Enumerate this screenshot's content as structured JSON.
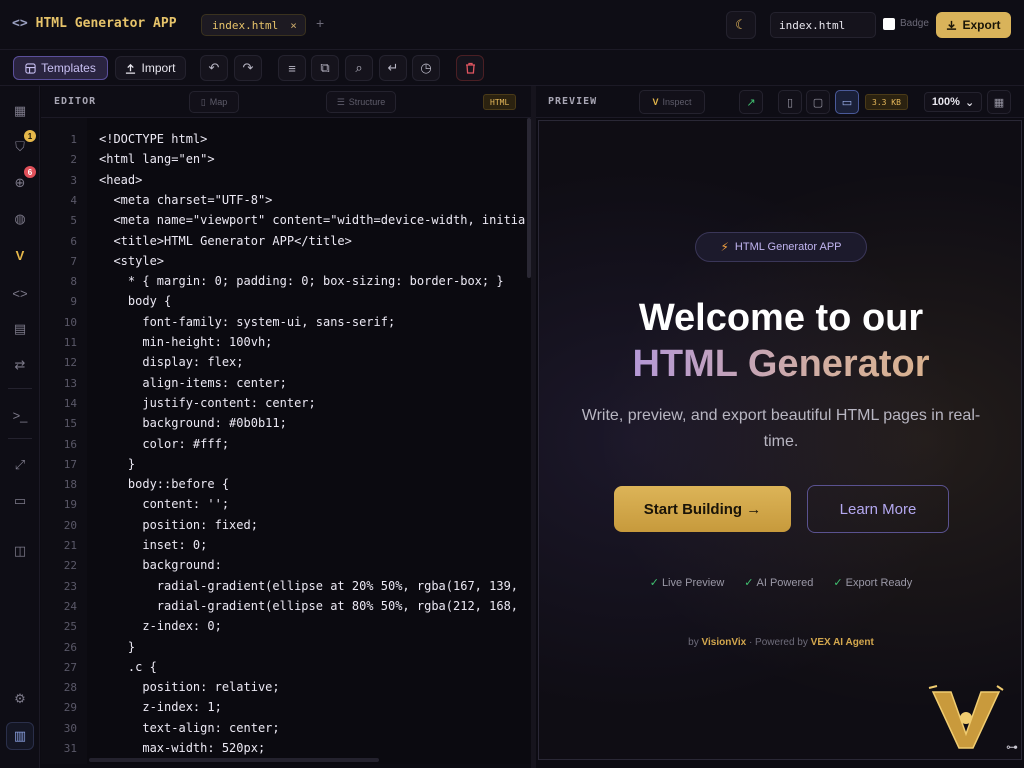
{
  "app": {
    "title": "HTML Generator APP",
    "tab_label": "index.html",
    "tab_close": "×",
    "add_tab": "+",
    "filename_value": "index.html",
    "badge_label": "Badge",
    "export_label": "Export"
  },
  "toolbar": {
    "templates_label": "Templates",
    "import_label": "Import",
    "icons": [
      "undo-icon",
      "redo-icon",
      "format-icon",
      "copy-icon",
      "search-icon",
      "wrap-icon",
      "history-icon",
      "delete-icon"
    ]
  },
  "sidebar": {
    "icons": [
      "grid-icon",
      "shield-icon",
      "zoom-icon",
      "palette-icon",
      "vex-logo-icon",
      "code-icon",
      "clipboard-icon",
      "sync-icon",
      "terminal-icon",
      "expand-icon",
      "monitor-icon",
      "columns-icon",
      "settings-icon",
      "book-icon"
    ],
    "shield_badge": "1",
    "zoom_badge": "6"
  },
  "editor": {
    "title": "EDITOR",
    "map_label": "Map",
    "structure_label": "Structure",
    "lang_label": "HTML",
    "lines": [
      "<!DOCTYPE html>",
      "<html lang=\"en\">",
      "<head>",
      "  <meta charset=\"UTF-8\">",
      "  <meta name=\"viewport\" content=\"width=device-width, initia",
      "  <title>HTML Generator APP</title>",
      "  <style>",
      "    * { margin: 0; padding: 0; box-sizing: border-box; }",
      "    body {",
      "      font-family: system-ui, sans-serif;",
      "      min-height: 100vh;",
      "      display: flex;",
      "      align-items: center;",
      "      justify-content: center;",
      "      background: #0b0b11;",
      "      color: #fff;",
      "    }",
      "    body::before {",
      "      content: '';",
      "      position: fixed;",
      "      inset: 0;",
      "      background:",
      "        radial-gradient(ellipse at 20% 50%, rgba(167, 139,",
      "        radial-gradient(ellipse at 80% 50%, rgba(212, 168,",
      "      z-index: 0;",
      "    }",
      "    .c {",
      "      position: relative;",
      "      z-index: 1;",
      "      text-align: center;",
      "      max-width: 520px;"
    ]
  },
  "preview": {
    "title": "PREVIEW",
    "inspect_label": "Inspect",
    "size_label": "3.3 KB",
    "zoom_value": "100%",
    "pill_text": "HTML Generator APP",
    "heading_line1": "Welcome to our",
    "heading_line2": "HTML Generator",
    "subtitle": "Write, preview, and export beautiful HTML pages in real-time.",
    "primary_cta": "Start Building →",
    "secondary_cta": "Learn More",
    "features": [
      "Live Preview",
      "AI Powered",
      "Export Ready"
    ],
    "credit_by": "by",
    "credit_brand": "VisionVix",
    "credit_mid": "· Powered by",
    "credit_agent": "VEX AI Agent"
  },
  "colors": {
    "accent_gold": "#d9b35a",
    "accent_purple": "#a68ef0",
    "background": "#0c0b12"
  }
}
